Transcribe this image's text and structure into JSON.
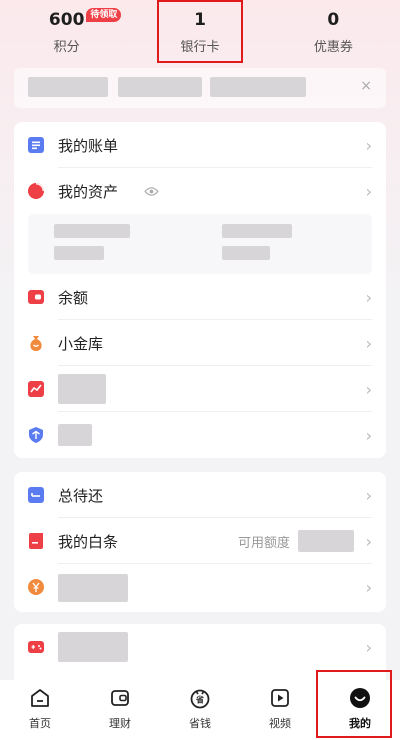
{
  "stats": [
    {
      "value": "600",
      "label": "积分",
      "badge": "待领取"
    },
    {
      "value": "1",
      "label": "银行卡"
    },
    {
      "value": "0",
      "label": "优惠券"
    }
  ],
  "banner": {
    "close": "×"
  },
  "section1": {
    "bill": "我的账单",
    "assets": "我的资产",
    "balance": "余额",
    "vault": "小金库"
  },
  "section2": {
    "pay_later": "总待还",
    "baitiao": "我的白条",
    "baitiao_right": "可用额度"
  },
  "tabbar": [
    {
      "label": "首页",
      "icon": "home-icon"
    },
    {
      "label": "理财",
      "icon": "wallet-icon"
    },
    {
      "label": "省钱",
      "icon": "coupon-icon"
    },
    {
      "label": "视频",
      "icon": "video-icon"
    },
    {
      "label": "我的",
      "icon": "profile-icon"
    }
  ],
  "chevron": "›",
  "colors": {
    "accent": "#ee3e46",
    "highlight": "#e0191b",
    "blue": "#5b7bf0",
    "orange": "#f08a3c"
  }
}
